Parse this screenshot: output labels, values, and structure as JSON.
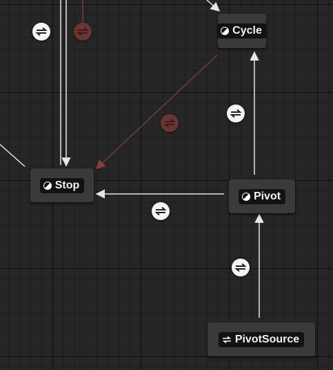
{
  "graph": {
    "nodes": {
      "cycle": {
        "label": "Cycle",
        "icon": "state-icon"
      },
      "stop": {
        "label": "Stop",
        "icon": "state-icon"
      },
      "pivot": {
        "label": "Pivot",
        "icon": "state-icon"
      },
      "pivot_source": {
        "label": "PivotSource",
        "icon": "conduit-icon"
      }
    },
    "transitions": [
      {
        "icon": "transition-rule-icon",
        "active": true
      },
      {
        "icon": "transition-rule-icon",
        "active": false
      },
      {
        "icon": "transition-rule-icon",
        "active": true
      },
      {
        "icon": "transition-rule-icon",
        "active": false
      },
      {
        "icon": "transition-rule-icon",
        "active": true
      },
      {
        "icon": "transition-rule-icon",
        "active": true
      }
    ],
    "colors": {
      "background": "#262626",
      "node_body": "#3a3a3a",
      "node_title": "#121212",
      "active_wire": "#e6e6e6",
      "inactive_wire": "#7a3a3a"
    }
  }
}
